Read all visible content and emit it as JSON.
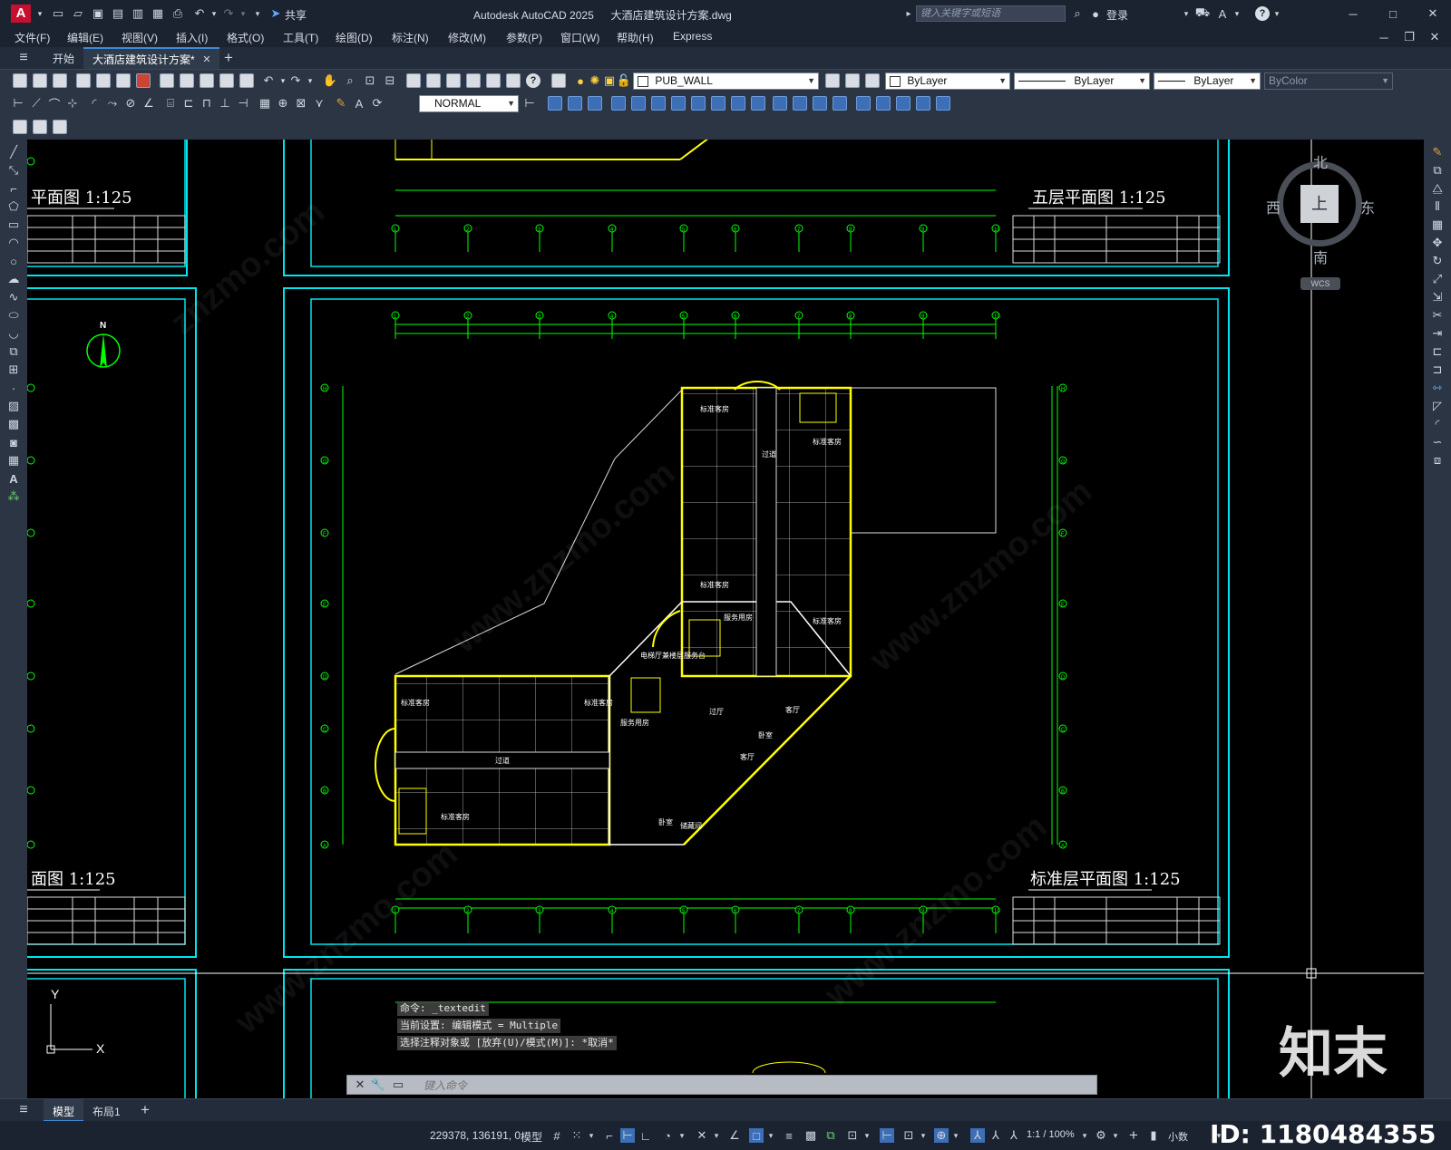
{
  "app": {
    "logo": "A",
    "title": "Autodesk AutoCAD 2025",
    "document": "大酒店建筑设计方案.dwg",
    "share_label": "共享",
    "search_placeholder": "键入关键字或短语",
    "login_label": "登录"
  },
  "menu": [
    "文件(F)",
    "编辑(E)",
    "视图(V)",
    "插入(I)",
    "格式(O)",
    "工具(T)",
    "绘图(D)",
    "标注(N)",
    "修改(M)",
    "参数(P)",
    "窗口(W)",
    "帮助(H)",
    "Express"
  ],
  "tabs": {
    "start": "开始",
    "active": "大酒店建筑设计方案*"
  },
  "toolbar": {
    "layer_name": "PUB_WALL",
    "color": "ByLayer",
    "linetype": "ByLayer",
    "lineweight": "ByLayer",
    "plotstyle": "ByColor",
    "dimstyle": "NORMAL"
  },
  "viewcube": {
    "north": "北",
    "south": "南",
    "east": "东",
    "west": "西",
    "face": "上",
    "wcs": "WCS"
  },
  "drawing": {
    "north_arrow": "N",
    "title_top_left": "平面图 1:125",
    "title_top_right": "五层平面图 1:125",
    "title_bottom_left": "面图 1:125",
    "title_main": "标准层平面图 1:125",
    "axes_top": [
      "1",
      "2",
      "3",
      "4",
      "5",
      "6",
      "7",
      "8",
      "9",
      "10"
    ],
    "axes_side": [
      "A",
      "B",
      "C",
      "D",
      "E",
      "F",
      "G",
      "H"
    ],
    "ucs_y": "Y",
    "ucs_x": "X",
    "rooms": [
      {
        "label": "标准客房"
      },
      {
        "label": "标准客房"
      },
      {
        "label": "标准客房"
      },
      {
        "label": "标准客房"
      },
      {
        "label": "标准客房"
      },
      {
        "label": "标准客房"
      },
      {
        "label": "标准客房"
      },
      {
        "label": "服务用房"
      },
      {
        "label": "电梯厅兼楼层服务台"
      },
      {
        "label": "服务用房"
      },
      {
        "label": "过道"
      },
      {
        "label": "过厅"
      },
      {
        "label": "客厅"
      },
      {
        "label": "客厅"
      },
      {
        "label": "卧室"
      },
      {
        "label": "卧室"
      },
      {
        "label": "过道"
      },
      {
        "label": "储藏间"
      }
    ]
  },
  "command": {
    "history": [
      "命令: _textedit",
      "当前设置: 编辑模式 = Multiple",
      "选择注释对象或 [放弃(U)/模式(M)]: *取消*"
    ],
    "placeholder": "键入命令"
  },
  "layouts": {
    "model": "模型",
    "layout1": "布局1"
  },
  "status": {
    "coords": "229378, 136191, 0",
    "mode": "模型",
    "scale": "1:1 / 100%",
    "units": "小数"
  },
  "overlay": {
    "brand": "知末",
    "id": "ID: 1180484355"
  },
  "colors": {
    "bg_canvas": "#000000",
    "frame": "#00e5ee",
    "dim": "#00ff00",
    "wall": "#ffffff",
    "window": "#ffff00"
  }
}
